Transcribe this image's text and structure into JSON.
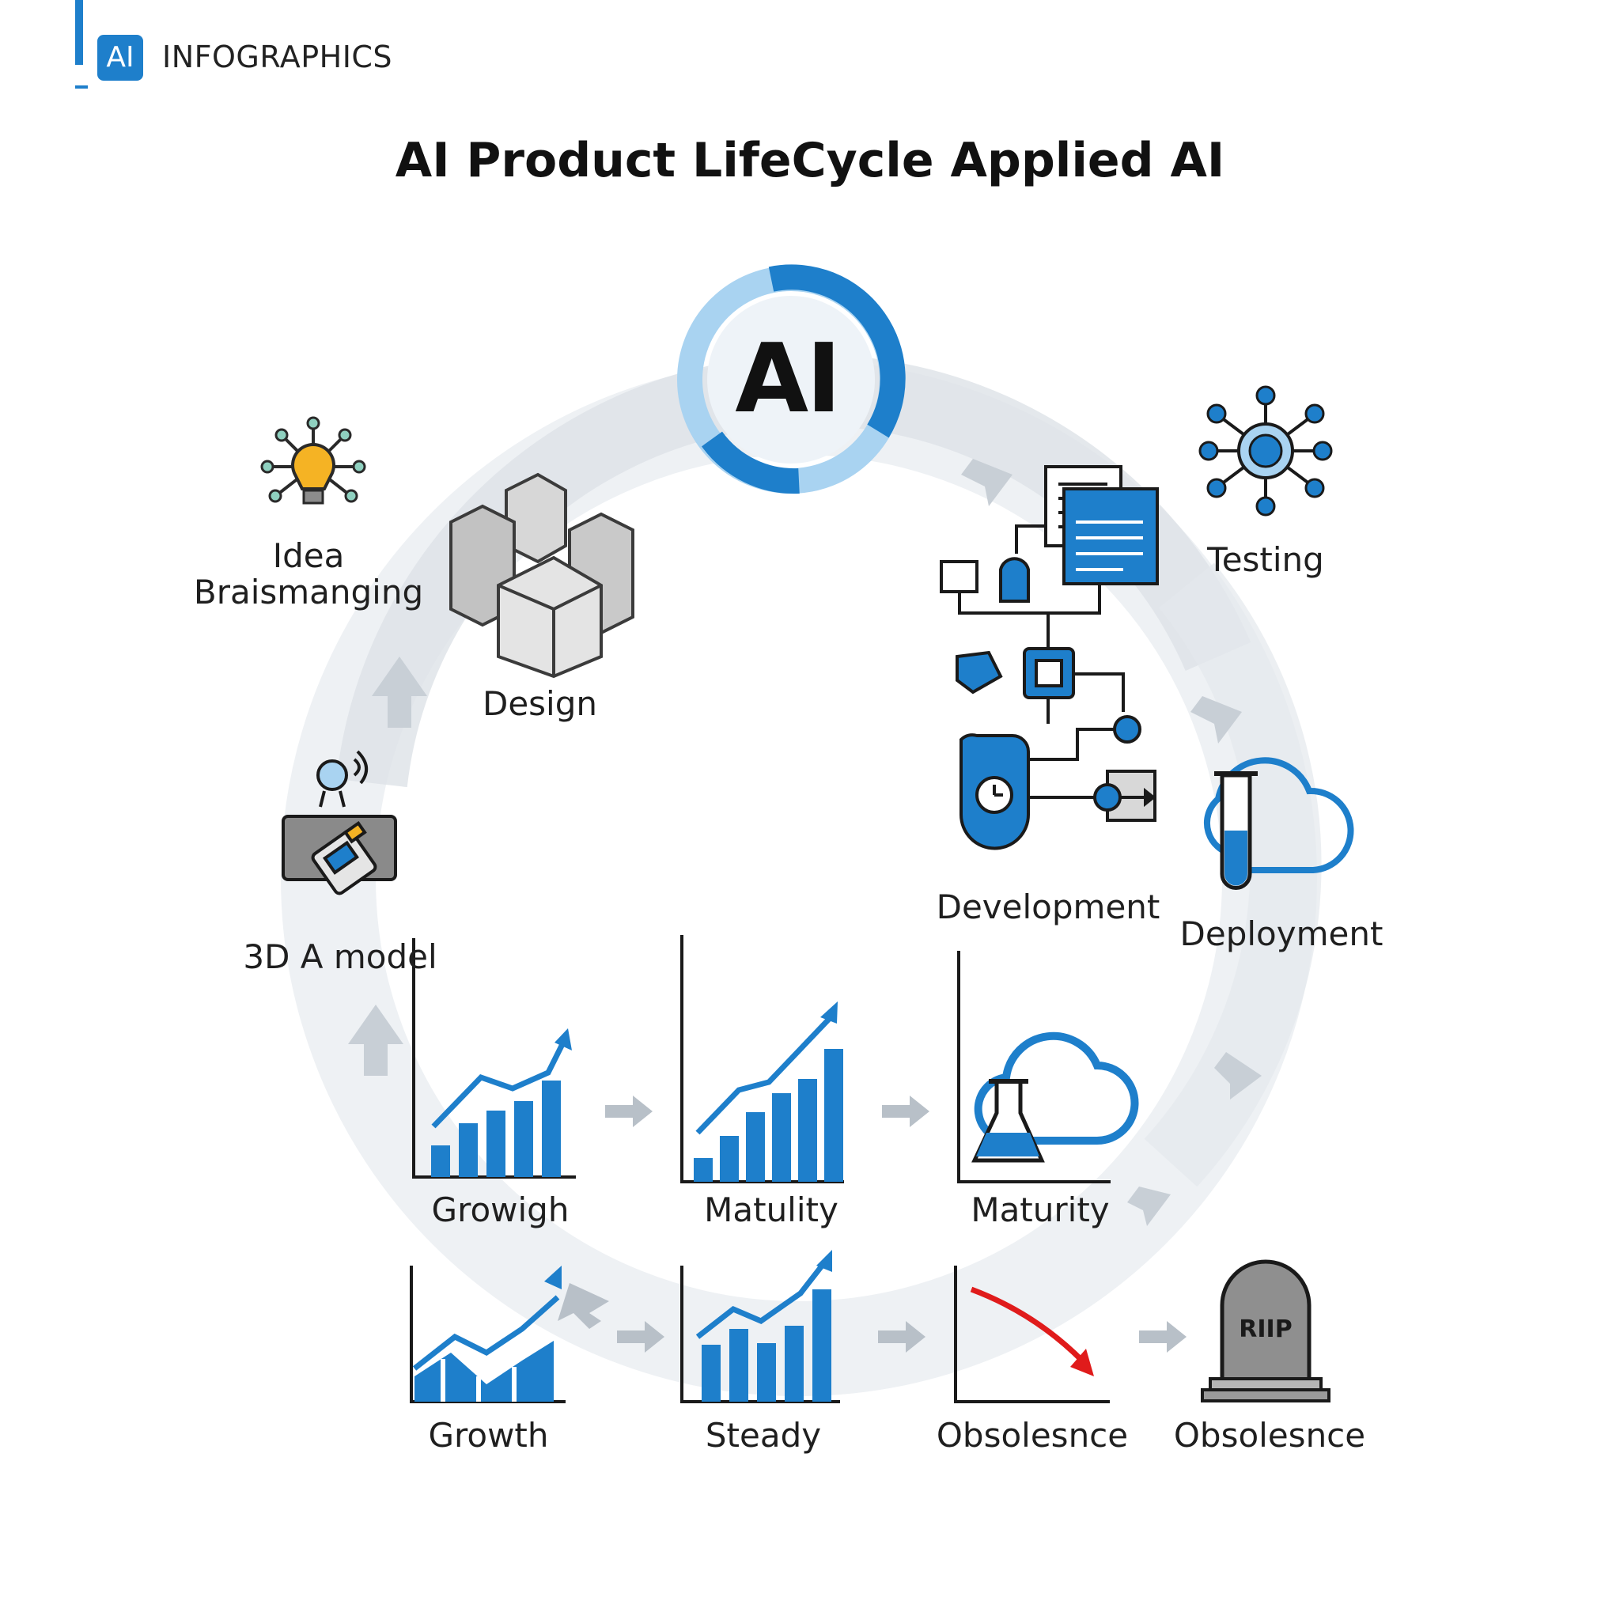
{
  "brand": {
    "logo_text": "AI",
    "text": "INFOGRAPHICS"
  },
  "title": "AI Product LifeCycle Applied AI",
  "hub": {
    "text": "AI"
  },
  "stages": {
    "idea": "Idea\nBraismanging",
    "design": "Design",
    "testing": "Testing",
    "development": "Development",
    "deployment": "Deployment",
    "model": "3D A model",
    "growigh": "Growigh",
    "matulity": "Matulity",
    "maturity": "Maturity",
    "growth": "Growth",
    "steady": "Steady",
    "obsolesnce_chart": "Obsolesnce",
    "obsolesnce_grave": "Obsolesnce"
  },
  "tombstone_text": "RIIP",
  "colors": {
    "accent": "#1e7fcb",
    "light_accent": "#a9d3f1",
    "ring": "#e6ebf0",
    "arrow": "#c8cfd6",
    "decline": "#e01b1b",
    "bulb": "#f5b324"
  },
  "icons": [
    "lightbulb-network-icon",
    "cubes-icon",
    "workflow-icon",
    "network-icon",
    "test-tube-cloud-icon",
    "scanner-icon",
    "bar-chart-icon",
    "flask-cloud-icon",
    "decline-chart-icon",
    "tombstone-icon"
  ]
}
